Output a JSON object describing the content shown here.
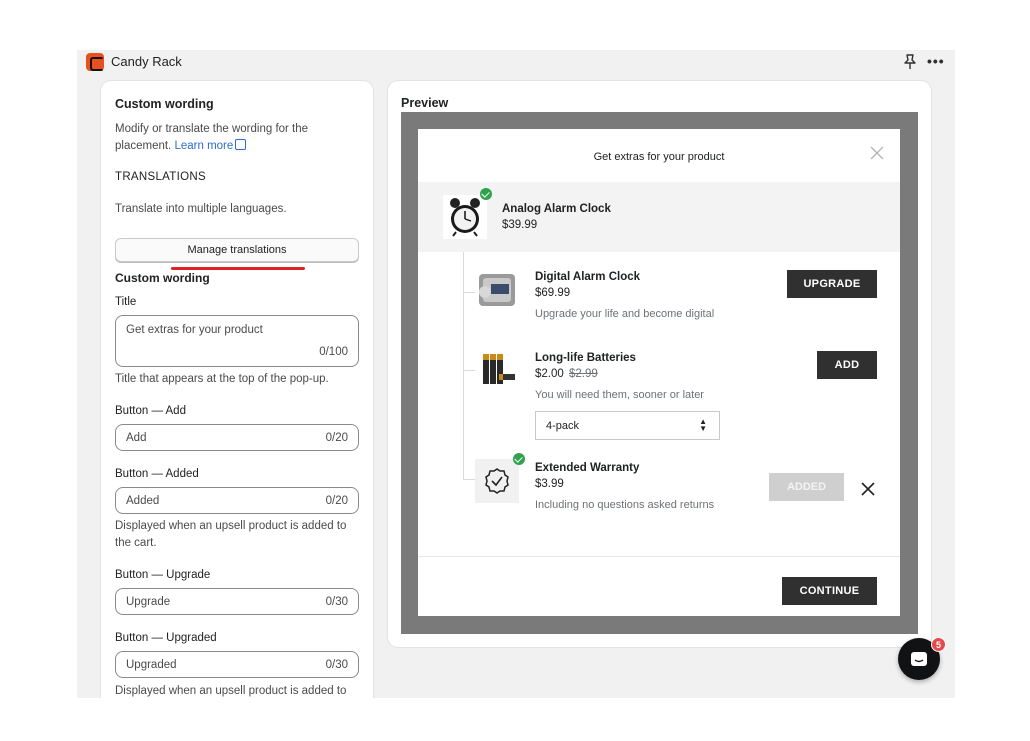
{
  "app": {
    "title": "Candy Rack"
  },
  "left": {
    "heading": "Custom wording",
    "description": "Modify or translate the wording for the placement.",
    "learn_more": "Learn more",
    "translations_heading": "TRANSLATIONS",
    "translations_text": "Translate into multiple languages.",
    "manage_button": "Manage translations",
    "custom_wording_heading": "Custom wording",
    "fields": {
      "title": {
        "label": "Title",
        "value": "Get extras for your product",
        "count": "0/100",
        "help": "Title that appears at the top of the pop-up."
      },
      "add": {
        "label": "Button — Add",
        "value": "Add",
        "count": "0/20"
      },
      "added": {
        "label": "Button — Added",
        "value": "Added",
        "count": "0/20",
        "help": "Displayed when an upsell product is added to the cart."
      },
      "upgrade": {
        "label": "Button — Upgrade",
        "value": "Upgrade",
        "count": "0/30"
      },
      "upgraded": {
        "label": "Button — Upgraded",
        "value": "Upgraded",
        "count": "0/30",
        "help": "Displayed when an upsell product is added to"
      }
    }
  },
  "preview": {
    "label": "Preview",
    "modal_title": "Get extras for your product",
    "main_product": {
      "name": "Analog Alarm Clock",
      "price": "$39.99"
    },
    "offers": [
      {
        "name": "Digital Alarm Clock",
        "price": "$69.99",
        "description": "Upgrade your life and become digital",
        "button": "UPGRADE"
      },
      {
        "name": "Long-life Batteries",
        "price": "$2.00",
        "old_price": "$2.99",
        "description": "You will need them, sooner or later",
        "button": "ADD",
        "variant": "4-pack"
      },
      {
        "name": "Extended Warranty",
        "price": "$3.99",
        "description": "Including no questions asked returns",
        "button": "ADDED"
      }
    ],
    "continue_button": "CONTINUE"
  },
  "chat": {
    "badge": "5"
  },
  "colors": {
    "brand": "#e8511f",
    "link": "#2c6ecb",
    "success": "#30a14e",
    "primary_button": "#303030",
    "badge": "#e5484d"
  }
}
